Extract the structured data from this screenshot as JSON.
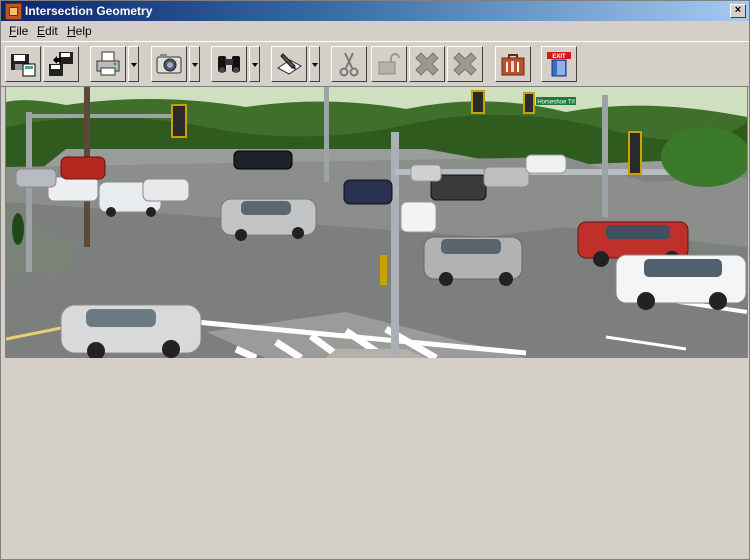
{
  "window": {
    "title": "Intersection Geometry",
    "close_glyph": "×"
  },
  "menu": {
    "items": [
      "File",
      "Edit",
      "Help"
    ]
  },
  "toolbar": {
    "buttons": [
      {
        "icon": "save-disk-icon",
        "label": ""
      },
      {
        "icon": "transfer-disk-icon",
        "label": ""
      },
      {
        "icon": "printer-icon",
        "label": "",
        "has_dropdown": true
      },
      {
        "icon": "camera-icon",
        "label": "",
        "has_dropdown": true
      },
      {
        "icon": "binoculars-icon",
        "label": "",
        "has_dropdown": true
      },
      {
        "icon": "edit-pen-icon",
        "label": "",
        "has_dropdown": true
      },
      {
        "icon": "cut-scissors-icon",
        "label": ""
      },
      {
        "icon": "unlock-icon",
        "label": ""
      },
      {
        "icon": "cross-x-icon",
        "label": ""
      },
      {
        "icon": "cross-x-icon",
        "label": ""
      },
      {
        "icon": "toolbox-icon",
        "label": ""
      },
      {
        "icon": "exit-door-icon",
        "label": "EXIT"
      }
    ]
  },
  "scene": {
    "street_sign": "Horseshoe Trl",
    "colors": {
      "sky": "#cfe0c0",
      "trees": "#3f6f2a",
      "asphalt": "#7d7f7e",
      "grass": "#5aa03c"
    }
  }
}
